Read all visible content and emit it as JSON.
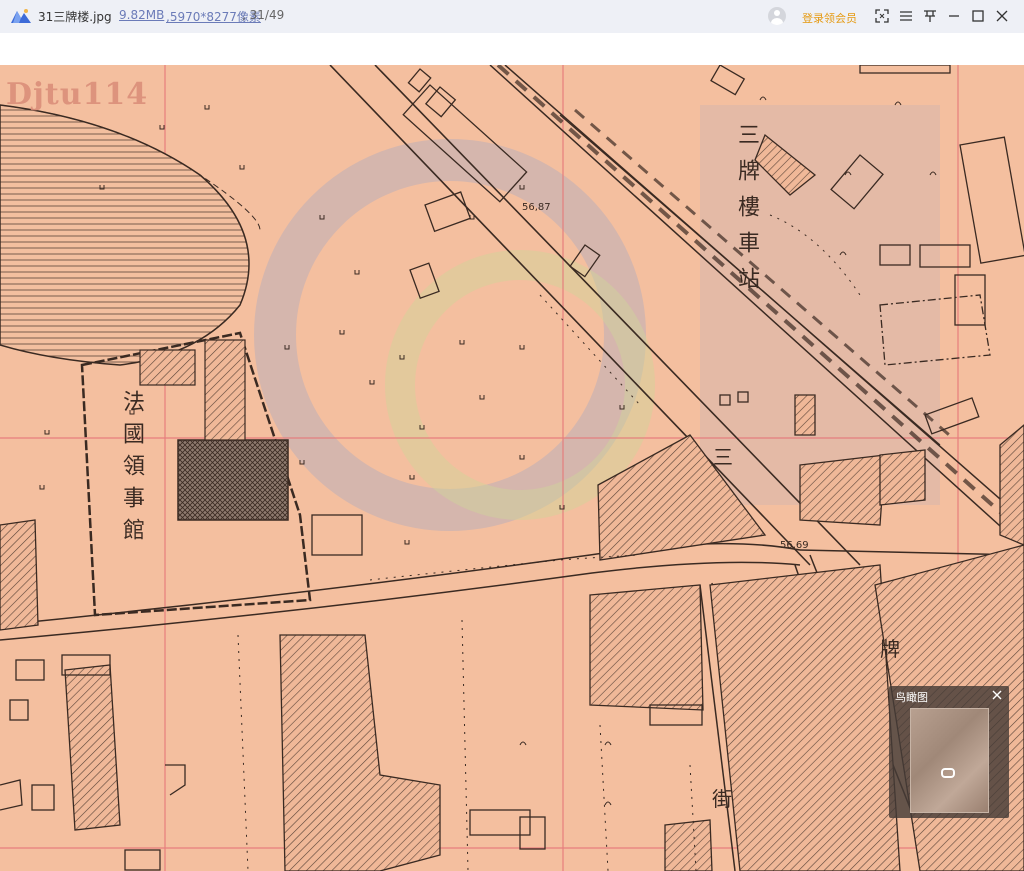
{
  "titlebar": {
    "file_name": "31三牌楼.jpg",
    "file_size": "9.82MB",
    "file_dims": ",5970*8277像素",
    "file_index": ", 31/49",
    "login_label": "登录领会员",
    "icons": [
      "app-logo-icon",
      "avatar-icon",
      "fullscreen-icon",
      "menu-icon",
      "pin-icon",
      "minimize-icon",
      "maximize-icon",
      "close-icon"
    ]
  },
  "map": {
    "watermark": "Djtu114",
    "labels": {
      "consulate": "法國領事館",
      "station": "三牌樓車站",
      "street_char_1": "三",
      "street_char_2": "牌",
      "street_char_3": "街",
      "elevation_1": "56,87",
      "elevation_2": "56,69"
    }
  },
  "birdeye": {
    "title": "鸟瞰图",
    "close_icon": "close-icon"
  },
  "colors": {
    "paper": "#f4bf9f",
    "grid_line": "#e5787a",
    "ink": "#3a2a22",
    "accent_orange": "#e59a12",
    "link_blue": "#6b7bb8"
  }
}
